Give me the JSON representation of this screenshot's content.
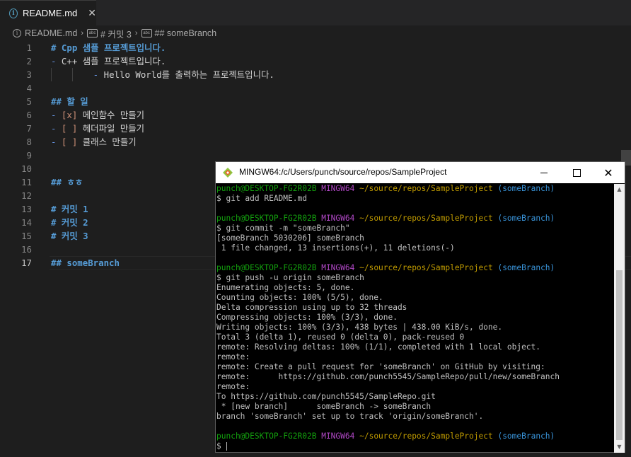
{
  "tab": {
    "label": "README.md",
    "close": "✕"
  },
  "breadcrumb": {
    "file": "README.md",
    "sep": "›",
    "item1": "# 커밋 3",
    "item2": "## someBranch",
    "abc_icon_text": "abc"
  },
  "editor": {
    "lines": [
      {
        "n": "1",
        "text": "# Cpp 샘플 프로젝트입니다.",
        "kind": "heading"
      },
      {
        "n": "2",
        "text": "- C++ 샘플 프로젝트입니다.",
        "kind": "list"
      },
      {
        "n": "3",
        "text": "        - Hello World를 출력하는 프로젝트입니다.",
        "kind": "list-indent"
      },
      {
        "n": "4",
        "text": "",
        "kind": "empty"
      },
      {
        "n": "5",
        "text": "## 할 일",
        "kind": "heading"
      },
      {
        "n": "6",
        "text": "- [x] 메인함수 만들기",
        "kind": "task",
        "box": "[x]",
        "label": "메인함수 만들기"
      },
      {
        "n": "7",
        "text": "- [ ] 헤더파일 만들기",
        "kind": "task",
        "box": "[ ]",
        "label": "헤더파일 만들기"
      },
      {
        "n": "8",
        "text": "- [ ] 클래스 만들기",
        "kind": "task",
        "box": "[ ]",
        "label": "클래스 만들기"
      },
      {
        "n": "9",
        "text": "",
        "kind": "empty"
      },
      {
        "n": "10",
        "text": "",
        "kind": "empty"
      },
      {
        "n": "11",
        "text": "## ㅎㅎ",
        "kind": "heading"
      },
      {
        "n": "12",
        "text": "",
        "kind": "empty"
      },
      {
        "n": "13",
        "text": "# 커밋 1",
        "kind": "heading"
      },
      {
        "n": "14",
        "text": "# 커밋 2",
        "kind": "heading"
      },
      {
        "n": "15",
        "text": "# 커밋 3",
        "kind": "heading"
      },
      {
        "n": "16",
        "text": "",
        "kind": "empty"
      },
      {
        "n": "17",
        "text": "## someBranch",
        "kind": "heading",
        "active": true
      }
    ]
  },
  "terminal": {
    "title": "MINGW64:/c/Users/punch/source/repos/SampleProject",
    "prompt": {
      "user": "punch@DESKTOP-FG2R02B",
      "system": "MINGW64",
      "path": "~/source/repos/SampleProject",
      "branch": "(someBranch)"
    },
    "lines": [
      {
        "type": "prompt"
      },
      {
        "type": "text",
        "text": "$ git add README.md"
      },
      {
        "type": "text",
        "text": ""
      },
      {
        "type": "prompt"
      },
      {
        "type": "text",
        "text": "$ git commit -m \"someBranch\""
      },
      {
        "type": "text",
        "text": "[someBranch 5030206] someBranch"
      },
      {
        "type": "text",
        "text": " 1 file changed, 13 insertions(+), 11 deletions(-)"
      },
      {
        "type": "text",
        "text": ""
      },
      {
        "type": "prompt"
      },
      {
        "type": "text",
        "text": "$ git push -u origin someBranch"
      },
      {
        "type": "text",
        "text": "Enumerating objects: 5, done."
      },
      {
        "type": "text",
        "text": "Counting objects: 100% (5/5), done."
      },
      {
        "type": "text",
        "text": "Delta compression using up to 32 threads"
      },
      {
        "type": "text",
        "text": "Compressing objects: 100% (3/3), done."
      },
      {
        "type": "text",
        "text": "Writing objects: 100% (3/3), 438 bytes | 438.00 KiB/s, done."
      },
      {
        "type": "text",
        "text": "Total 3 (delta 1), reused 0 (delta 0), pack-reused 0"
      },
      {
        "type": "text",
        "text": "remote: Resolving deltas: 100% (1/1), completed with 1 local object."
      },
      {
        "type": "text",
        "text": "remote:"
      },
      {
        "type": "text",
        "text": "remote: Create a pull request for 'someBranch' on GitHub by visiting:"
      },
      {
        "type": "text",
        "text": "remote:      https://github.com/punch5545/SampleRepo/pull/new/someBranch"
      },
      {
        "type": "text",
        "text": "remote:"
      },
      {
        "type": "text",
        "text": "To https://github.com/punch5545/SampleRepo.git"
      },
      {
        "type": "text",
        "text": " * [new branch]      someBranch -> someBranch"
      },
      {
        "type": "text",
        "text": "branch 'someBranch' set up to track 'origin/someBranch'."
      },
      {
        "type": "text",
        "text": ""
      },
      {
        "type": "prompt"
      },
      {
        "type": "cursor",
        "text": "$ "
      }
    ],
    "buttons": {
      "minimize": "minimize",
      "maximize": "maximize",
      "close": "✕"
    }
  }
}
